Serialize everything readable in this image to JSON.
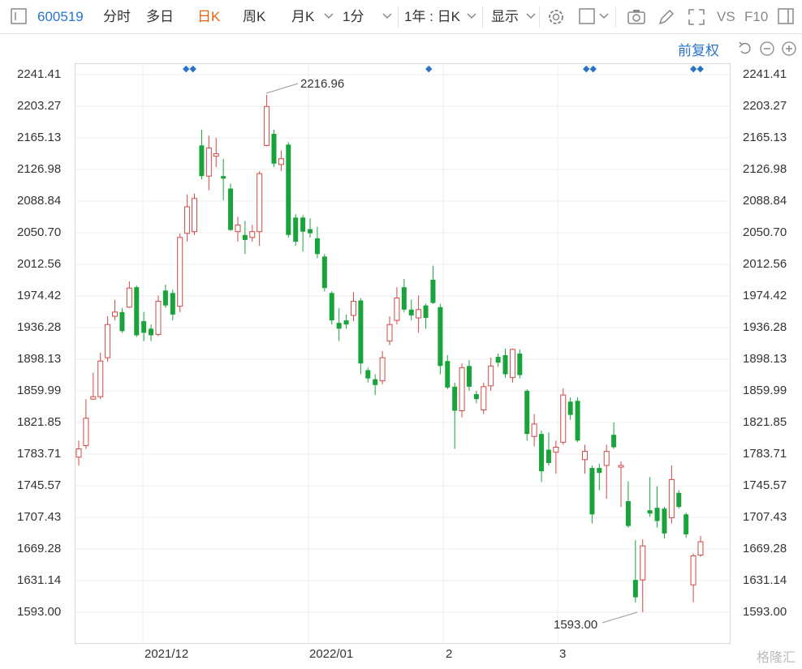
{
  "toolbar": {
    "code": "600519",
    "items": [
      {
        "label": "分时"
      },
      {
        "label": "多日"
      },
      {
        "label": "日K"
      },
      {
        "label": "周K"
      },
      {
        "label": "月K"
      },
      {
        "label": "1分"
      },
      {
        "label": "1年 : 日K"
      },
      {
        "label": "显示"
      },
      {
        "label": "VS"
      },
      {
        "label": "F10"
      }
    ],
    "active_item": "日K",
    "adjust_label": "前复权",
    "colors": {
      "accent": "#e8640c",
      "link": "#2a74c8"
    }
  },
  "chart_data": {
    "type": "candlestick",
    "y_ticks": [
      "2241.41",
      "2203.27",
      "2165.13",
      "2126.98",
      "2088.84",
      "2050.70",
      "2012.56",
      "1974.42",
      "1936.28",
      "1898.13",
      "1859.99",
      "1821.85",
      "1783.71",
      "1745.57",
      "1707.43",
      "1669.28",
      "1631.14",
      "1593.00"
    ],
    "ylim": [
      1573.93,
      2260.48
    ],
    "x_ticks": [
      "2021/12",
      "2022/01",
      "2",
      "3"
    ],
    "grid": true,
    "colors": {
      "up": "#d24846",
      "down": "#19a33b"
    },
    "annotations": {
      "high": "2216.96",
      "low": "1593.00"
    },
    "candles": [
      {
        "o": 1780,
        "c": 1790,
        "h": 1800,
        "l": 1770
      },
      {
        "o": 1794,
        "c": 1827,
        "h": 1850,
        "l": 1790
      },
      {
        "o": 1850,
        "c": 1853,
        "h": 1882,
        "l": 1849
      },
      {
        "o": 1853,
        "c": 1896,
        "h": 1906,
        "l": 1850
      },
      {
        "o": 1900,
        "c": 1940,
        "h": 1950,
        "l": 1895
      },
      {
        "o": 1950,
        "c": 1955,
        "h": 1970,
        "l": 1945
      },
      {
        "o": 1955,
        "c": 1932,
        "h": 1960,
        "l": 1930
      },
      {
        "o": 1961,
        "c": 1984,
        "h": 1992,
        "l": 1960
      },
      {
        "o": 1985,
        "c": 1927,
        "h": 1987,
        "l": 1925
      },
      {
        "o": 1944,
        "c": 1930,
        "h": 1955,
        "l": 1920
      },
      {
        "o": 1935,
        "c": 1927,
        "h": 1940,
        "l": 1920
      },
      {
        "o": 1928,
        "c": 1968,
        "h": 1975,
        "l": 1926
      },
      {
        "o": 1981,
        "c": 1963,
        "h": 1988,
        "l": 1960
      },
      {
        "o": 1978,
        "c": 1952,
        "h": 1982,
        "l": 1945
      },
      {
        "o": 1962,
        "c": 2045,
        "h": 2050,
        "l": 1955
      },
      {
        "o": 2050,
        "c": 2082,
        "h": 2097,
        "l": 2040
      },
      {
        "o": 2052,
        "c": 2092,
        "h": 2098,
        "l": 2048
      },
      {
        "o": 2156,
        "c": 2119,
        "h": 2175,
        "l": 2115
      },
      {
        "o": 2119,
        "c": 2153,
        "h": 2168,
        "l": 2102
      },
      {
        "o": 2143,
        "c": 2146,
        "h": 2165,
        "l": 2130
      },
      {
        "o": 2119,
        "c": 2116,
        "h": 2140,
        "l": 2090
      },
      {
        "o": 2104,
        "c": 2054,
        "h": 2110,
        "l": 2053
      },
      {
        "o": 2052,
        "c": 2060,
        "h": 2070,
        "l": 2040
      },
      {
        "o": 2048,
        "c": 2042,
        "h": 2065,
        "l": 2025
      },
      {
        "o": 2045,
        "c": 2052,
        "h": 2060,
        "l": 2040
      },
      {
        "o": 2052,
        "c": 2122,
        "h": 2125,
        "l": 2035
      },
      {
        "o": 2156,
        "c": 2203,
        "h": 2217,
        "l": 2155
      },
      {
        "o": 2170,
        "c": 2134,
        "h": 2175,
        "l": 2130
      },
      {
        "o": 2133,
        "c": 2140,
        "h": 2150,
        "l": 2125
      },
      {
        "o": 2157,
        "c": 2048,
        "h": 2160,
        "l": 2045
      },
      {
        "o": 2069,
        "c": 2040,
        "h": 2073,
        "l": 2035
      },
      {
        "o": 2069,
        "c": 2052,
        "h": 2072,
        "l": 2028
      },
      {
        "o": 2055,
        "c": 2050,
        "h": 2068,
        "l": 2045
      },
      {
        "o": 2044,
        "c": 2025,
        "h": 2058,
        "l": 2020
      },
      {
        "o": 2022,
        "c": 1984,
        "h": 2025,
        "l": 1980
      },
      {
        "o": 1978,
        "c": 1945,
        "h": 1980,
        "l": 1940
      },
      {
        "o": 1942,
        "c": 1935,
        "h": 1960,
        "l": 1920
      },
      {
        "o": 1945,
        "c": 1940,
        "h": 1952,
        "l": 1935
      },
      {
        "o": 1951,
        "c": 1968,
        "h": 1979,
        "l": 1944
      },
      {
        "o": 1969,
        "c": 1893,
        "h": 1972,
        "l": 1880
      },
      {
        "o": 1885,
        "c": 1875,
        "h": 1888,
        "l": 1870
      },
      {
        "o": 1874,
        "c": 1867,
        "h": 1880,
        "l": 1855
      },
      {
        "o": 1872,
        "c": 1900,
        "h": 1908,
        "l": 1868
      },
      {
        "o": 1920,
        "c": 1940,
        "h": 1950,
        "l": 1915
      },
      {
        "o": 1945,
        "c": 1972,
        "h": 1985,
        "l": 1940
      },
      {
        "o": 1985,
        "c": 1958,
        "h": 1995,
        "l": 1955
      },
      {
        "o": 1958,
        "c": 1951,
        "h": 1970,
        "l": 1945
      },
      {
        "o": 1948,
        "c": 1958,
        "h": 1975,
        "l": 1930
      },
      {
        "o": 1963,
        "c": 1948,
        "h": 1965,
        "l": 1935
      },
      {
        "o": 1994,
        "c": 1966,
        "h": 2011,
        "l": 1965
      },
      {
        "o": 1961,
        "c": 1890,
        "h": 1965,
        "l": 1880
      },
      {
        "o": 1896,
        "c": 1864,
        "h": 1903,
        "l": 1862
      },
      {
        "o": 1865,
        "c": 1836,
        "h": 1870,
        "l": 1790
      },
      {
        "o": 1836,
        "c": 1888,
        "h": 1893,
        "l": 1828
      },
      {
        "o": 1890,
        "c": 1865,
        "h": 1897,
        "l": 1860
      },
      {
        "o": 1856,
        "c": 1850,
        "h": 1860,
        "l": 1845
      },
      {
        "o": 1837,
        "c": 1865,
        "h": 1870,
        "l": 1832
      },
      {
        "o": 1866,
        "c": 1890,
        "h": 1900,
        "l": 1860
      },
      {
        "o": 1901,
        "c": 1894,
        "h": 1905,
        "l": 1889
      },
      {
        "o": 1903,
        "c": 1880,
        "h": 1911,
        "l": 1876
      },
      {
        "o": 1876,
        "c": 1910,
        "h": 1911,
        "l": 1870
      },
      {
        "o": 1905,
        "c": 1879,
        "h": 1910,
        "l": 1875
      },
      {
        "o": 1860,
        "c": 1808,
        "h": 1862,
        "l": 1800
      },
      {
        "o": 1805,
        "c": 1820,
        "h": 1832,
        "l": 1793
      },
      {
        "o": 1808,
        "c": 1763,
        "h": 1812,
        "l": 1750
      },
      {
        "o": 1789,
        "c": 1773,
        "h": 1810,
        "l": 1770
      },
      {
        "o": 1786,
        "c": 1792,
        "h": 1800,
        "l": 1760
      },
      {
        "o": 1798,
        "c": 1855,
        "h": 1863,
        "l": 1795
      },
      {
        "o": 1847,
        "c": 1831,
        "h": 1852,
        "l": 1825
      },
      {
        "o": 1848,
        "c": 1800,
        "h": 1852,
        "l": 1798
      },
      {
        "o": 1777,
        "c": 1787,
        "h": 1795,
        "l": 1760
      },
      {
        "o": 1767,
        "c": 1711,
        "h": 1770,
        "l": 1700
      },
      {
        "o": 1767,
        "c": 1761,
        "h": 1772,
        "l": 1740
      },
      {
        "o": 1770,
        "c": 1787,
        "h": 1795,
        "l": 1730
      },
      {
        "o": 1807,
        "c": 1792,
        "h": 1822,
        "l": 1790
      },
      {
        "o": 1768,
        "c": 1770,
        "h": 1775,
        "l": 1720
      },
      {
        "o": 1727,
        "c": 1697,
        "h": 1751,
        "l": 1695
      },
      {
        "o": 1632,
        "c": 1611,
        "h": 1680,
        "l": 1605
      },
      {
        "o": 1632,
        "c": 1673,
        "h": 1681,
        "l": 1593
      },
      {
        "o": 1716,
        "c": 1712,
        "h": 1756,
        "l": 1708
      },
      {
        "o": 1719,
        "c": 1703,
        "h": 1745,
        "l": 1695
      },
      {
        "o": 1718,
        "c": 1688,
        "h": 1720,
        "l": 1682
      },
      {
        "o": 1707,
        "c": 1753,
        "h": 1770,
        "l": 1700
      },
      {
        "o": 1737,
        "c": 1720,
        "h": 1740,
        "l": 1718
      },
      {
        "o": 1711,
        "c": 1687,
        "h": 1713,
        "l": 1683
      },
      {
        "o": 1626,
        "c": 1661,
        "h": 1664,
        "l": 1605
      },
      {
        "o": 1662,
        "c": 1678,
        "h": 1685,
        "l": 1660
      }
    ]
  },
  "brand": {
    "watermark": "格隆汇"
  }
}
